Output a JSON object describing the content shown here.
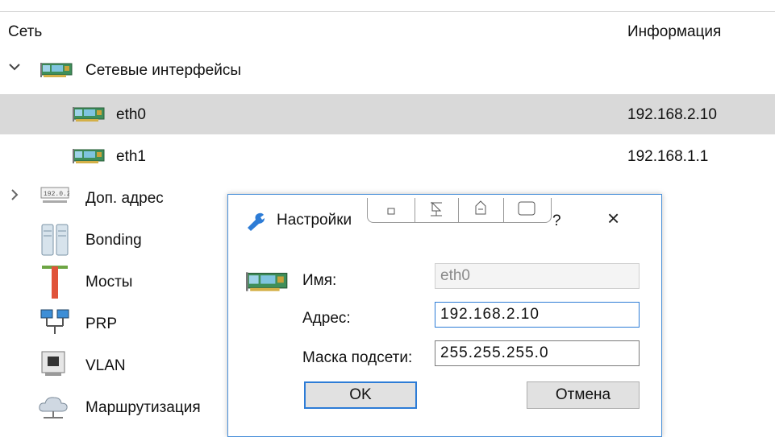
{
  "header": {
    "col_network": "Сеть",
    "col_info": "Информация"
  },
  "tree": {
    "interfaces_group": "Сетевые интерфейсы",
    "interfaces": [
      {
        "name": "eth0",
        "info": "192.168.2.10",
        "selected": true
      },
      {
        "name": "eth1",
        "info": "192.168.1.1",
        "selected": false
      }
    ],
    "other_items": [
      {
        "label": "Доп. адрес",
        "icon": "ip-address-icon"
      },
      {
        "label": "Bonding",
        "icon": "bonding-icon"
      },
      {
        "label": "Мосты",
        "icon": "bridge-icon"
      },
      {
        "label": "PRP",
        "icon": "prp-icon"
      },
      {
        "label": "VLAN",
        "icon": "vlan-icon"
      },
      {
        "label": "Маршрутизация",
        "icon": "routing-icon"
      }
    ]
  },
  "dialog": {
    "title": "Настройки",
    "help": "?",
    "close": "×",
    "name_label": "Имя:",
    "name_value": "eth0",
    "address_label": "Адрес:",
    "address_value": "192.168.2.10",
    "mask_label": "Маска подсети:",
    "mask_value": "255.255.255.0",
    "ok_label": "OK",
    "cancel_label": "Отмена"
  },
  "colors": {
    "selection": "#d9d9d9",
    "focus_border": "#2d7cd6",
    "nic_green": "#5aa35a"
  }
}
